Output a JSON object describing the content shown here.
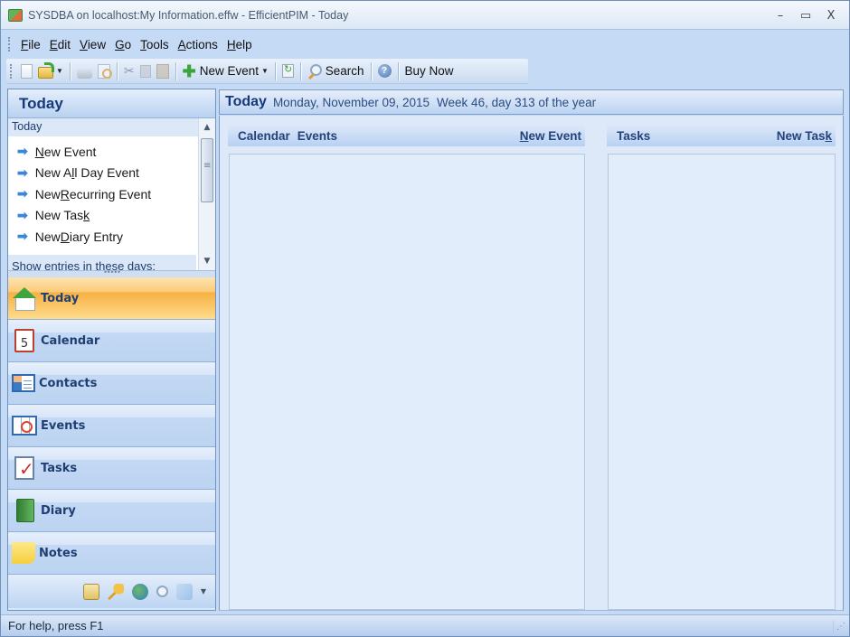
{
  "window": {
    "title": "SYSDBA on localhost:My Information.effw - EfficientPIM - Today",
    "controls": {
      "minimize": "–",
      "maximize": "▭",
      "close": "X"
    }
  },
  "menu": [
    {
      "label": "File",
      "accel": "F",
      "rest": "ile"
    },
    {
      "label": "Edit",
      "accel": "E",
      "rest": "dit"
    },
    {
      "label": "View",
      "accel": "V",
      "rest": "iew"
    },
    {
      "label": "Go",
      "accel": "G",
      "rest": "o"
    },
    {
      "label": "Tools",
      "accel": "T",
      "rest": "ools"
    },
    {
      "label": "Actions",
      "accel": "A",
      "rest": "ctions"
    },
    {
      "label": "Help",
      "accel": "H",
      "rest": "elp"
    }
  ],
  "toolbar": {
    "new_event_label": "New Event",
    "search_label": "Search",
    "buy_now_label": "Buy Now",
    "dropdown_caret": "▼",
    "cut_glyph": "✂",
    "help_glyph": "?",
    "plus_glyph": "✚"
  },
  "nav": {
    "header": "Today",
    "tasks_title": "Today",
    "task_links": [
      {
        "pre": "",
        "accel": "N",
        "post": "ew Event"
      },
      {
        "pre": "New A",
        "accel": "l",
        "post": "l Day Event"
      },
      {
        "pre": "New ",
        "accel": "R",
        "post": "ecurring Event"
      },
      {
        "pre": "New Tas",
        "accel": "k",
        "post": ""
      },
      {
        "pre": "New ",
        "accel": "D",
        "post": "iary Entry"
      }
    ],
    "arrow_glyph": "➡",
    "show_entries": "Show entries in these days:",
    "splitter_grip": "•••••",
    "scroll_up": "▲",
    "scroll_down": "▼",
    "buttons": [
      {
        "label": "Today",
        "icon": "home-icon",
        "active": true
      },
      {
        "label": "Calendar",
        "icon": "calendar-icon",
        "calendar_day": "5"
      },
      {
        "label": "Contacts",
        "icon": "contacts-icon"
      },
      {
        "label": "Events",
        "icon": "events-icon"
      },
      {
        "label": "Tasks",
        "icon": "tasks-icon"
      },
      {
        "label": "Diary",
        "icon": "diary-icon"
      },
      {
        "label": "Notes",
        "icon": "notes-icon"
      }
    ],
    "footer_more": "▼"
  },
  "main": {
    "title": "Today",
    "date": "Monday, November 09, 2015",
    "week_info": "Week 46, day 313 of the year",
    "calendar_panel": {
      "heading1": "Calendar",
      "heading2": "Events",
      "link": {
        "pre": "",
        "accel": "N",
        "post": "ew Event"
      }
    },
    "tasks_panel": {
      "heading": "Tasks",
      "link": {
        "pre": "New Tas",
        "accel": "k",
        "post": ""
      }
    }
  },
  "status": {
    "text": "For help, press F1",
    "grip": "⋰"
  }
}
